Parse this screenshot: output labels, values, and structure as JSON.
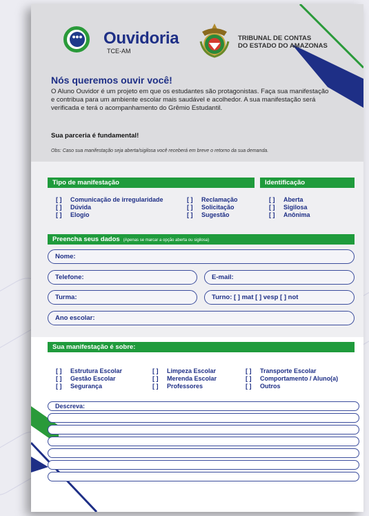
{
  "header": {
    "brand_title": "Ouvidoria",
    "brand_sub": "TCE-AM",
    "tribunal_line1": "TRIBUNAL DE CONTAS",
    "tribunal_line2": "DO ESTADO DO AMAZONAS"
  },
  "intro": {
    "headline": "Nós queremos ouvir você!",
    "paragraph": "O Aluno Ouvidor é um projeto em que os estudantes são protagonistas. Faça sua manifestação e contribua para um ambiente escolar mais saudável e acolhedor. A sua manifestação será verificada e terá o acompanhamento do Grêmio Estudantil.",
    "strong_line": "Sua parceria é fundamental!",
    "obs": "Obs:  Caso sua manifestação seja aberta/sigilosa você receberá em breve o retorno da sua demanda."
  },
  "tipo": {
    "title": "Tipo de manifestação",
    "col1": [
      "Comunicação de irregularidade",
      "Dúvida",
      "Elogio"
    ],
    "col2": [
      "Reclamação",
      "Solicitação",
      "Sugestão"
    ]
  },
  "identificacao": {
    "title": "Identificação",
    "options": [
      "Aberta",
      "Sigilosa",
      "Anônima"
    ]
  },
  "dados": {
    "title": "Preencha seus dados",
    "note": "(Apenas se marcar a opção aberta ou sigilosa)",
    "nome": "Nome:",
    "telefone": "Telefone:",
    "email": "E-mail:",
    "turma": "Turma:",
    "turno": "Turno:  [   ]  mat  [   ]   vesp  [   ]   not",
    "ano": "Ano escolar:"
  },
  "sobre": {
    "title": "Sua manifestação é sobre:",
    "col1": [
      "Estrutura Escolar",
      "Gestão Escolar",
      "Segurança"
    ],
    "col2": [
      "Limpeza Escolar",
      "Merenda Escolar",
      "Professores"
    ],
    "col3": [
      "Transporte Escolar",
      "Comportamento / Aluno(a)",
      "Outros"
    ]
  },
  "descreva": {
    "label": "Descreva:"
  },
  "checkbox_mark": "[   ]",
  "colors": {
    "navy": "#1e2f86",
    "green": "#1f9b3c",
    "field_border": "#3a4c9c"
  },
  "icons": [
    "chat-bubble-icon",
    "state-seal-emblem"
  ]
}
